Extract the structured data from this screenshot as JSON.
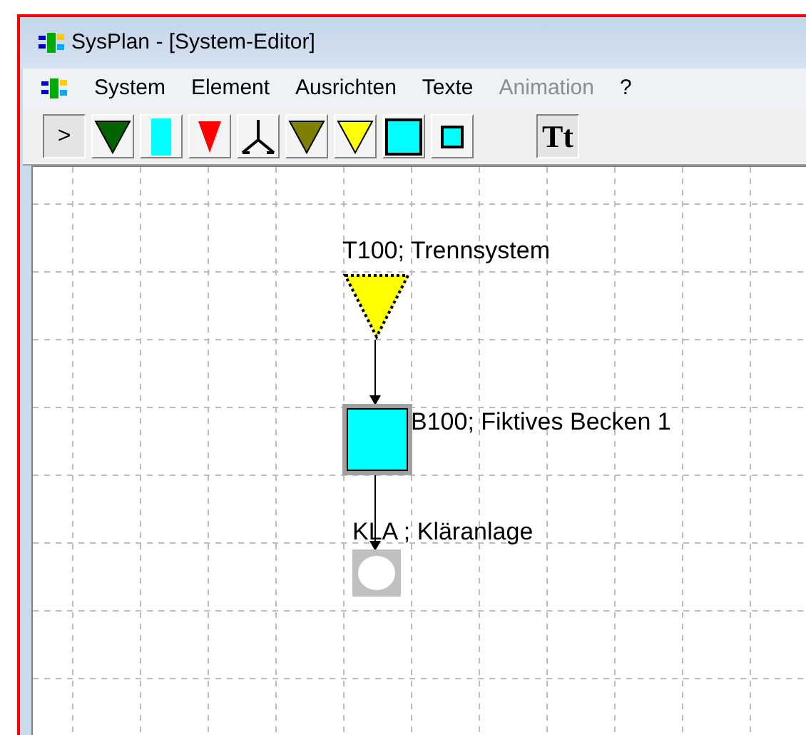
{
  "window": {
    "title": "SysPlan - [System-Editor]"
  },
  "menu": [
    {
      "label": "System",
      "disabled": false
    },
    {
      "label": "Element",
      "disabled": false
    },
    {
      "label": "Ausrichten",
      "disabled": false
    },
    {
      "label": "Texte",
      "disabled": false
    },
    {
      "label": "Animation",
      "disabled": true
    },
    {
      "label": "?",
      "disabled": false
    }
  ],
  "toolbar": [
    {
      "kind": "pointer",
      "label": ">",
      "selected": true
    },
    {
      "kind": "triangle",
      "color": "#006400",
      "selected": false
    },
    {
      "kind": "tall-rect",
      "color": "#00ffff",
      "selected": false
    },
    {
      "kind": "small-triangle",
      "color": "#ff0000",
      "selected": false
    },
    {
      "kind": "splitter",
      "selected": false
    },
    {
      "kind": "triangle",
      "color": "#808000",
      "selected": false
    },
    {
      "kind": "triangle",
      "color": "#ffff00",
      "selected": false
    },
    {
      "kind": "square",
      "color": "#00ffff",
      "selected": false
    },
    {
      "kind": "small-square",
      "color": "#00ffff",
      "selected": false
    },
    {
      "kind": "text",
      "label": "Tt",
      "selected": true
    }
  ],
  "canvas": {
    "nodes": [
      {
        "kind": "triangle",
        "color": "#ffff00",
        "label": "T100; Trennsystem",
        "selected": true
      },
      {
        "kind": "square",
        "color": "#00ffff",
        "label": "B100; Fiktives Becken 1",
        "selected": false
      },
      {
        "kind": "circle",
        "label": "KLA ; Kläranlage",
        "selected": false
      }
    ]
  }
}
